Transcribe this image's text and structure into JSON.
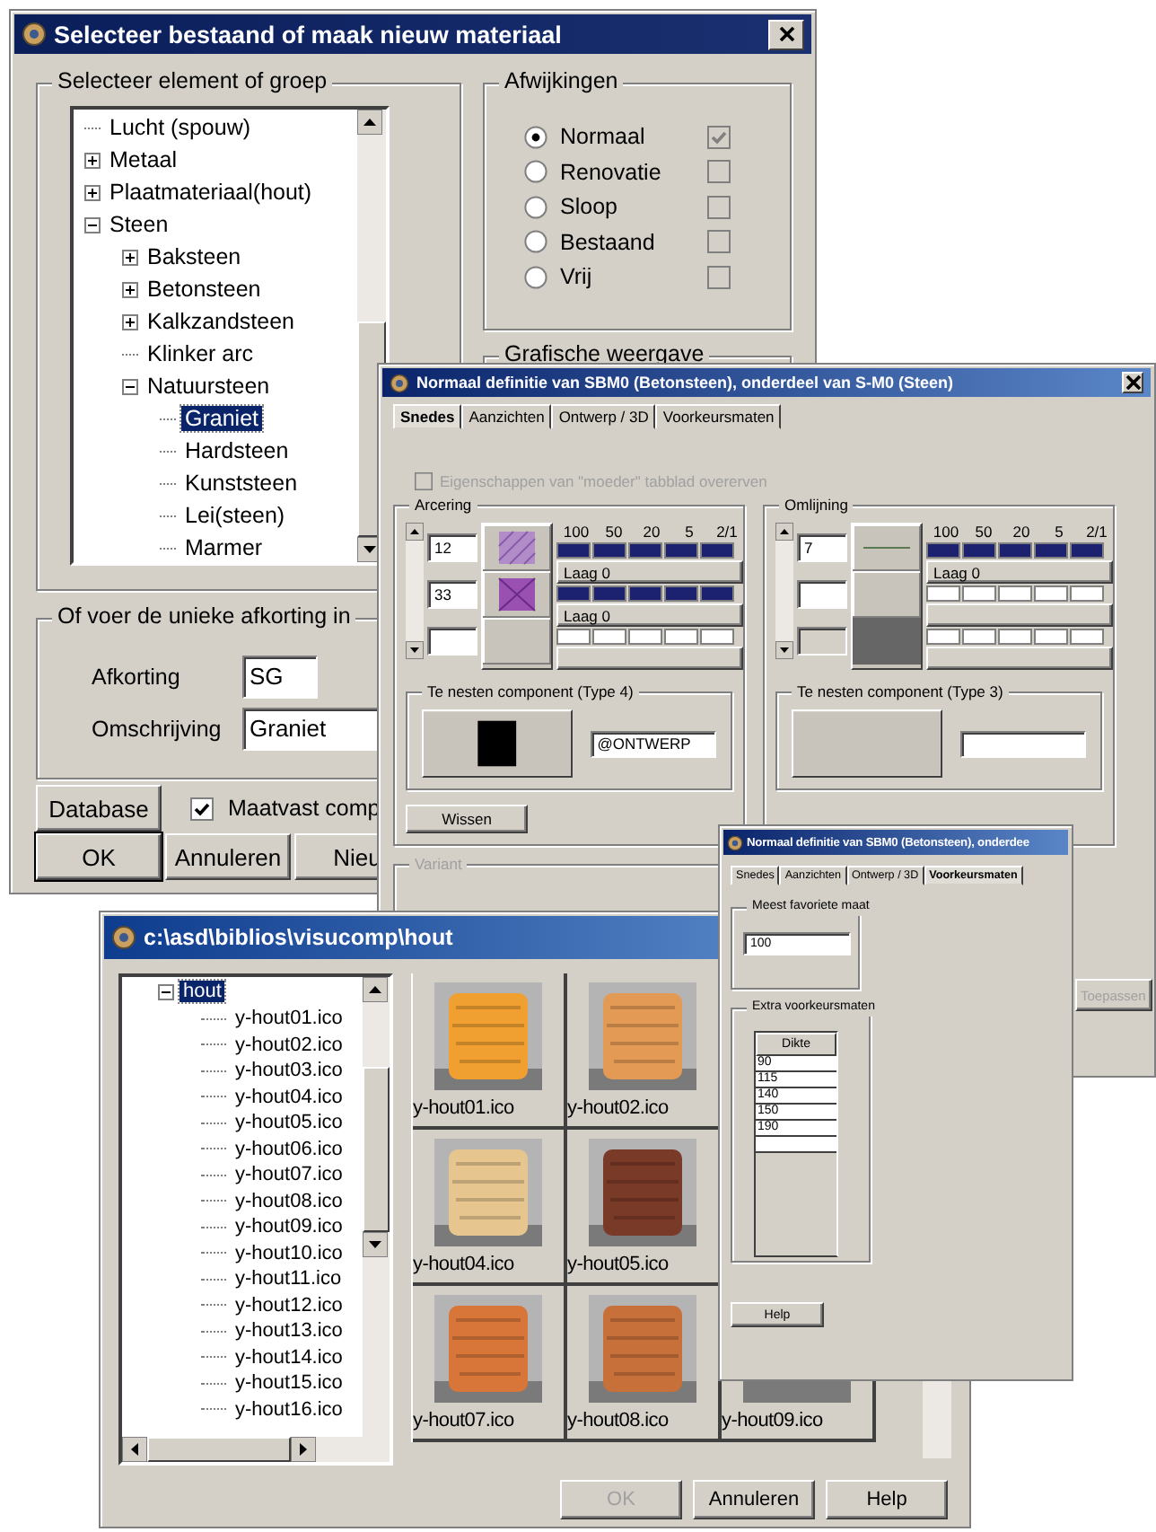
{
  "material_dialog": {
    "title": "Selecteer bestaand of maak nieuw materiaal",
    "tree_group": {
      "label": "Selecteer element of groep",
      "tree": [
        {
          "label": "Lucht (spouw)",
          "kind": "item",
          "selected": false
        },
        {
          "label": "Metaal",
          "kind": "group",
          "expanded": false,
          "selected": false
        },
        {
          "label": "Plaatmateriaal(hout)",
          "kind": "group",
          "expanded": false,
          "selected": false
        },
        {
          "label": "Steen",
          "kind": "group",
          "expanded": true,
          "selected": false,
          "children": [
            {
              "label": "Baksteen",
              "kind": "group",
              "expanded": false,
              "selected": false
            },
            {
              "label": "Betonsteen",
              "kind": "group",
              "expanded": false,
              "selected": false
            },
            {
              "label": "Kalkzandsteen",
              "kind": "group",
              "expanded": false,
              "selected": false
            },
            {
              "label": "Klinker arc",
              "kind": "item",
              "selected": false
            },
            {
              "label": "Natuursteen",
              "kind": "group",
              "expanded": true,
              "selected": false,
              "children": [
                {
                  "label": "Graniet",
                  "kind": "item",
                  "selected": true
                },
                {
                  "label": "Hardsteen",
                  "kind": "item",
                  "selected": false
                },
                {
                  "label": "Kunststeen",
                  "kind": "item",
                  "selected": false
                },
                {
                  "label": "Lei(steen)",
                  "kind": "item",
                  "selected": false
                },
                {
                  "label": "Marmer",
                  "kind": "item",
                  "selected": false
                }
              ]
            }
          ]
        }
      ]
    },
    "deviations_group": {
      "label": "Afwijkingen",
      "options": [
        {
          "label": "Normaal",
          "selected": true,
          "checked": true
        },
        {
          "label": "Renovatie",
          "selected": false,
          "checked": false
        },
        {
          "label": "Sloop",
          "selected": false,
          "checked": false
        },
        {
          "label": "Bestaand",
          "selected": false,
          "checked": false
        },
        {
          "label": "Vrij",
          "selected": false,
          "checked": false
        }
      ]
    },
    "graphics_group": {
      "label": "Grafische weergave"
    },
    "code_group": {
      "label": "Of voer de unieke afkorting in",
      "fields": [
        {
          "label": "Afkorting",
          "value": "SG"
        },
        {
          "label": "Omschrijving",
          "value": "Graniet"
        }
      ]
    },
    "database_button": "Database",
    "fixed_checkbox": {
      "label": "Maatvast comp",
      "checked": true
    },
    "buttons": [
      "OK",
      "Annuleren",
      "Nieu"
    ]
  },
  "definition_dialog": {
    "title": "Normaal definitie van SBM0 (Betonsteen), onderdeel van S-M0 (Steen)",
    "tabs": [
      {
        "label": "Snedes",
        "selected": true
      },
      {
        "label": "Aanzichten",
        "selected": false
      },
      {
        "label": "Ontwerp / 3D",
        "selected": false
      },
      {
        "label": "Voorkeursmaten",
        "selected": false
      }
    ],
    "inherit_checkbox": {
      "label": "Eigenschappen van \"moeder\" tabblad overerven",
      "checked": false,
      "disabled": true
    },
    "panels": [
      {
        "label": "Arcering",
        "pens": [
          {
            "value": "12",
            "kind": "hatch-light",
            "disabled": false
          },
          {
            "value": "33",
            "kind": "hatch-dark",
            "disabled": false
          },
          {
            "kind": "plain",
            "disabled": false
          }
        ],
        "scales": [
          "100",
          "50",
          "20",
          "5",
          "2/1"
        ],
        "layers": [
          {
            "filled": true,
            "button": "Laag 0"
          },
          {
            "filled": true,
            "button": "Laag 0"
          },
          {
            "filled": false
          }
        ],
        "component": {
          "label": "Te nesten component (Type 4)",
          "kind": "black",
          "value": "@ONTWERP"
        },
        "clear_button": "Wissen"
      },
      {
        "label": "Omlijning",
        "pens": [
          {
            "value": "7",
            "kind": "line",
            "disabled": false
          },
          {
            "kind": "plain",
            "disabled": false
          },
          {
            "kind": "dark",
            "disabled": true
          }
        ],
        "scales": [
          "100",
          "50",
          "20",
          "5",
          "2/1"
        ],
        "layers": [
          {
            "filled": true,
            "button": "Laag 0"
          },
          {
            "filled": false
          },
          {
            "filled": false
          }
        ],
        "component": {
          "label": "Te nesten component (Type 3)",
          "kind": "plain"
        }
      }
    ],
    "variant_group": {
      "label": "Variant",
      "disabled": true
    },
    "apply_button": {
      "label": "Toepassen",
      "disabled": true
    }
  },
  "folder_dialog": {
    "title": "c:\\asd\\biblios\\visucomp\\hout",
    "tree": [
      {
        "label": "hout",
        "kind": "group",
        "expanded": true,
        "selected": true,
        "children": [
          {
            "label": "y-hout01.ico",
            "kind": "item",
            "selected": false
          },
          {
            "label": "y-hout02.ico",
            "kind": "item",
            "selected": false
          },
          {
            "label": "y-hout03.ico",
            "kind": "item",
            "selected": false
          },
          {
            "label": "y-hout04.ico",
            "kind": "item",
            "selected": false
          },
          {
            "label": "y-hout05.ico",
            "kind": "item",
            "selected": false
          },
          {
            "label": "y-hout06.ico",
            "kind": "item",
            "selected": false
          },
          {
            "label": "y-hout07.ico",
            "kind": "item",
            "selected": false
          },
          {
            "label": "y-hout08.ico",
            "kind": "item",
            "selected": false
          },
          {
            "label": "y-hout09.ico",
            "kind": "item",
            "selected": false
          },
          {
            "label": "y-hout10.ico",
            "kind": "item",
            "selected": false
          },
          {
            "label": "y-hout11.ico",
            "kind": "item",
            "selected": false
          },
          {
            "label": "y-hout12.ico",
            "kind": "item",
            "selected": false
          },
          {
            "label": "y-hout13.ico",
            "kind": "item",
            "selected": false
          },
          {
            "label": "y-hout14.ico",
            "kind": "item",
            "selected": false
          },
          {
            "label": "y-hout15.ico",
            "kind": "item",
            "selected": false
          },
          {
            "label": "y-hout16.ico",
            "kind": "item",
            "selected": false
          }
        ]
      }
    ],
    "thumbnails": [
      [
        {
          "label": "y-hout01.ico",
          "color": "#f0a030"
        },
        {
          "label": "y-hout02.ico",
          "color": "#e39a55"
        }
      ],
      [
        {
          "label": "y-hout04.ico",
          "color": "#e6c68e"
        },
        {
          "label": "y-hout05.ico",
          "color": "#7a3a28"
        }
      ],
      [
        {
          "label": "y-hout07.ico",
          "color": "#d8763a"
        },
        {
          "label": "y-hout08.ico",
          "color": "#c8703a"
        },
        {
          "label": "y-hout09.ico"
        }
      ]
    ],
    "buttons": [
      {
        "label": "OK",
        "disabled": true
      },
      {
        "label": "Annuleren",
        "disabled": false
      },
      {
        "label": "Help",
        "disabled": false
      }
    ]
  },
  "preferences_dialog": {
    "title": "Normaal definitie van SBM0 (Betonsteen), onderdee",
    "tabs": [
      {
        "label": "Snedes",
        "selected": false
      },
      {
        "label": "Aanzichten",
        "selected": false
      },
      {
        "label": "Ontwerp / 3D",
        "selected": false
      },
      {
        "label": "Voorkeursmaten",
        "selected": true
      }
    ],
    "favorite_group": {
      "label": "Meest favoriete maat",
      "value": "100"
    },
    "extra_group": {
      "label": "Extra voorkeursmaten",
      "column": "Dikte",
      "rows": [
        "90",
        "115",
        "140",
        "150",
        "190"
      ]
    },
    "help_button": "Help"
  }
}
